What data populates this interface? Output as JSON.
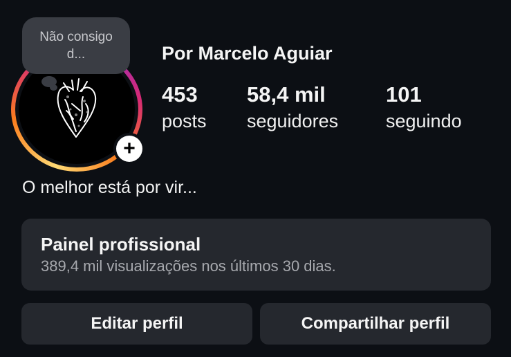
{
  "profile": {
    "name": "Por Marcelo Aguiar",
    "note": "Não consigo d...",
    "avatar_icon": "anatomical-heart-icon",
    "bio": "O melhor está por vir..."
  },
  "stats": {
    "posts": {
      "value": "453",
      "label": "posts"
    },
    "followers": {
      "value": "58,4 mil",
      "label": "seguidores"
    },
    "following": {
      "value": "101",
      "label": "seguindo"
    }
  },
  "panel": {
    "title": "Painel profissional",
    "subtitle": "389,4 mil visualizações nos últimos 30 dias."
  },
  "buttons": {
    "edit": "Editar perfil",
    "share": "Compartilhar perfil"
  },
  "add_symbol": "+",
  "colors": {
    "background": "#0c0f14",
    "card": "#25282e",
    "note": "#3a3d44",
    "secondary_text": "#a7a9ae"
  }
}
